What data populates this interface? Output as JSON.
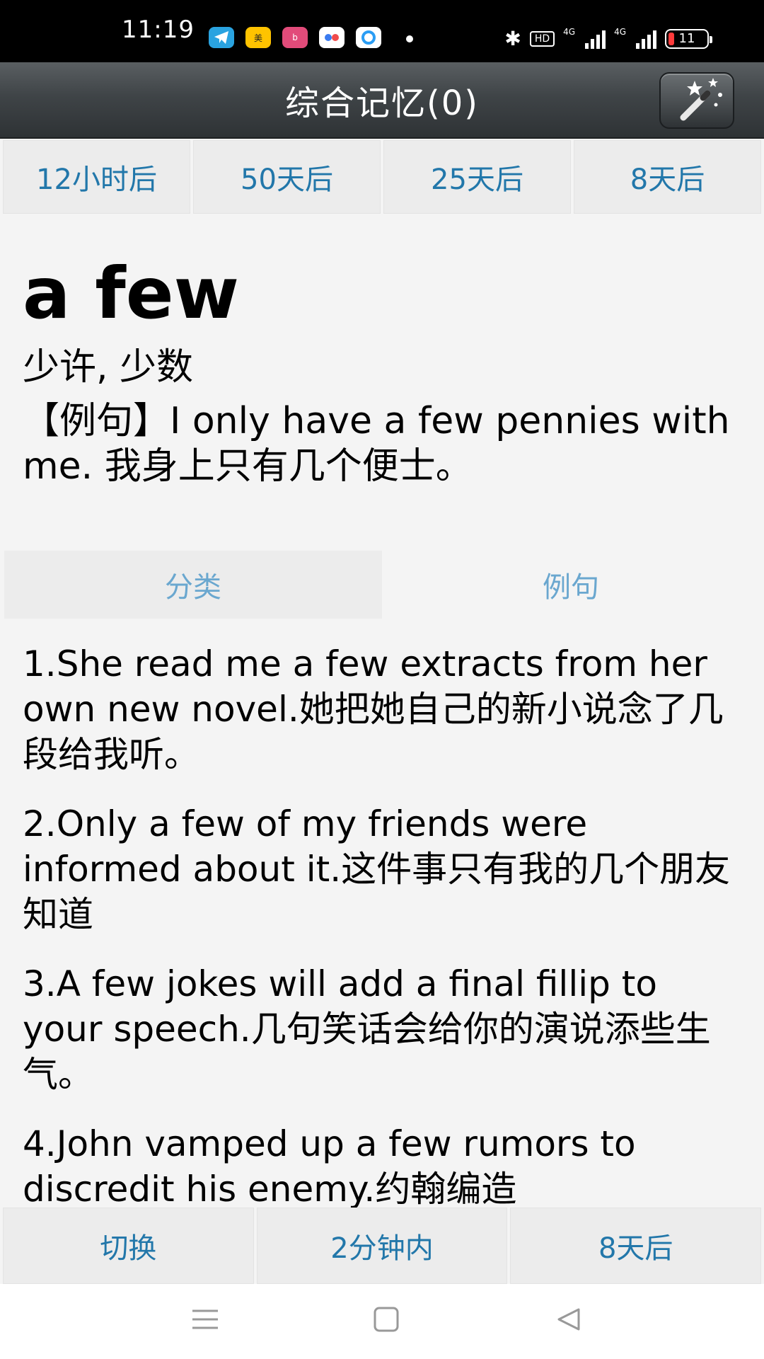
{
  "status_bar": {
    "time": "11:19",
    "app_icons": [
      "telegram-icon",
      "meituan-icon",
      "bilibili-icon",
      "cloud-icon",
      "app-icon"
    ],
    "hd_label": "HD",
    "network_1": "4G",
    "network_2": "4G",
    "battery": "11"
  },
  "header": {
    "title": "综合记忆(0)",
    "wand_icon": "magic-wand-icon"
  },
  "top_buttons": [
    {
      "label": "12小时后"
    },
    {
      "label": "50天后"
    },
    {
      "label": "25天后"
    },
    {
      "label": "8天后"
    }
  ],
  "word": {
    "text": "a few",
    "meaning": "少许, 少数",
    "example_line": "【例句】I only have a few pennies with me. 我身上只有几个便士。"
  },
  "tabs": [
    {
      "label": "分类",
      "active": true
    },
    {
      "label": "例句",
      "active": false
    }
  ],
  "examples": [
    "1.She read me a few extracts from her own new novel.她把她自己的新小说念了几段给我听。",
    "2.Only a few of my friends were informed about it.这件事只有我的几个朋友知道",
    "3.A few jokes will add a final fillip to your speech.几句笑话会给你的演说添些生气。",
    "4.John vamped up a few rumors to discredit his enemy.约翰编造"
  ],
  "bottom_buttons": [
    {
      "label": "切换"
    },
    {
      "label": "2分钟内"
    },
    {
      "label": "8天后"
    }
  ],
  "nav": {
    "menu_icon": "menu-icon",
    "home_icon": "home-icon",
    "back_icon": "back-icon"
  },
  "colors": {
    "header_bg": "#3f4447",
    "button_text": "#2277aa",
    "tab_text": "#6aa7cf",
    "page_bg": "#f4f4f4"
  }
}
